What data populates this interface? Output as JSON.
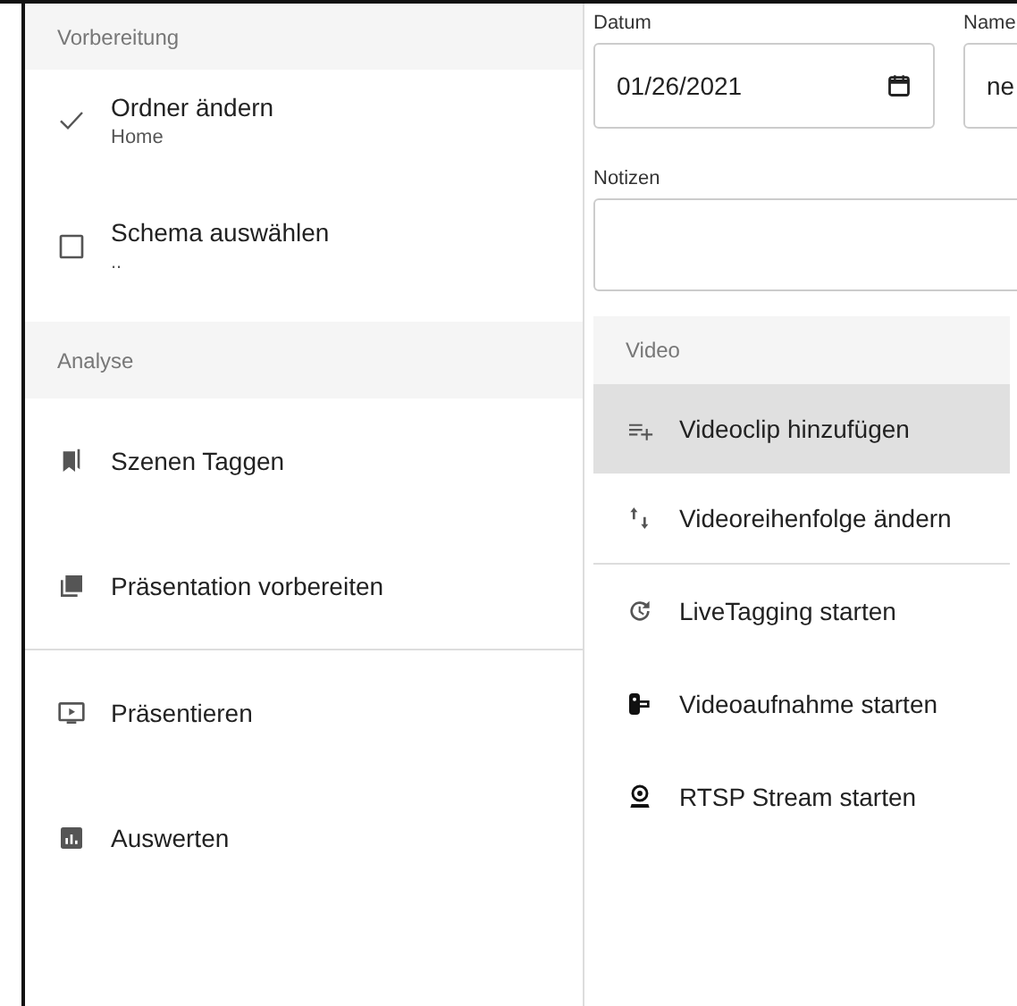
{
  "sidebar": {
    "sections": [
      {
        "title": "Vorbereitung",
        "items": [
          {
            "kind": "step",
            "label": "Ordner ändern",
            "value": "Home",
            "checked": true
          },
          {
            "kind": "step",
            "label": "Schema auswählen",
            "value": "..",
            "checked": false
          }
        ]
      },
      {
        "title": "Analyse",
        "items": [
          {
            "kind": "action",
            "label": "Szenen Taggen"
          },
          {
            "kind": "action",
            "label": "Präsentation vorbereiten"
          },
          {
            "kind": "divider"
          },
          {
            "kind": "action",
            "label": "Präsentieren"
          },
          {
            "kind": "action",
            "label": "Auswerten"
          }
        ]
      }
    ]
  },
  "form": {
    "date": {
      "label": "Datum",
      "value": "01/26/2021"
    },
    "name": {
      "label": "Name",
      "value": "ne"
    },
    "notes": {
      "label": "Notizen"
    }
  },
  "video": {
    "title": "Video",
    "items": [
      {
        "kind": "action",
        "label": "Videoclip hinzufügen",
        "selected": true
      },
      {
        "kind": "action",
        "label": "Videoreihenfolge ändern",
        "selected": false
      },
      {
        "kind": "divider"
      },
      {
        "kind": "action",
        "label": "LiveTagging starten",
        "selected": false
      },
      {
        "kind": "action",
        "label": "Videoaufnahme starten",
        "selected": false
      },
      {
        "kind": "action",
        "label": "RTSP Stream starten",
        "selected": false
      }
    ]
  }
}
